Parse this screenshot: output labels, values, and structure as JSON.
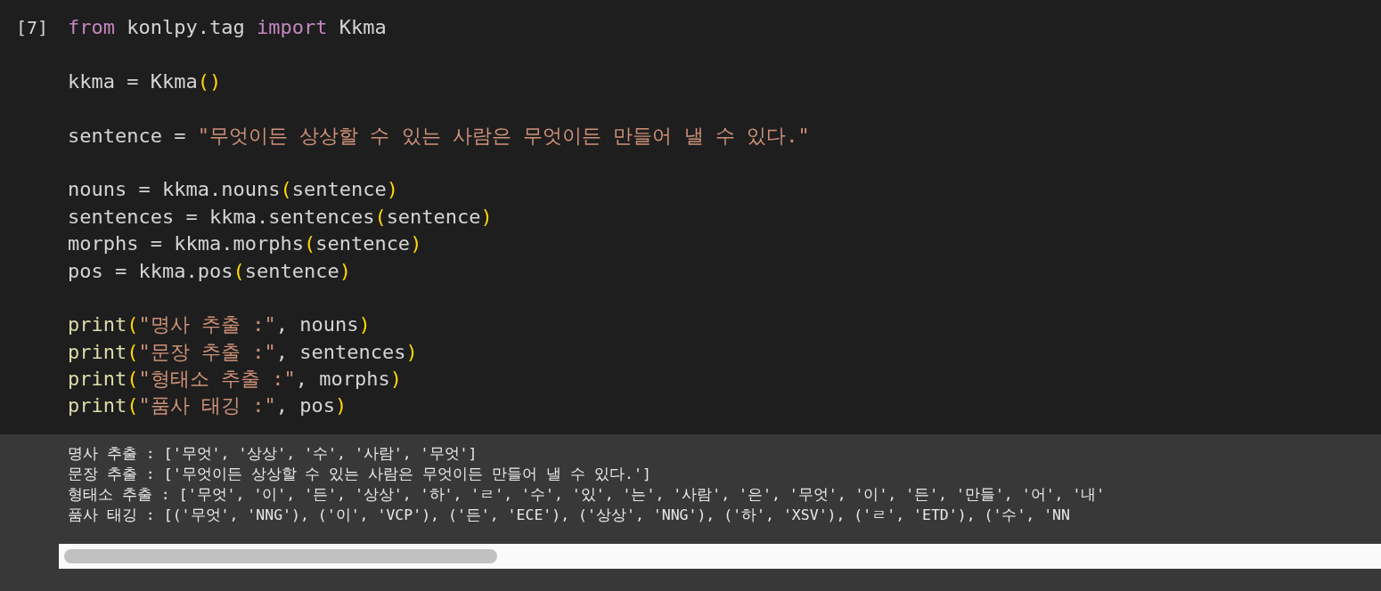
{
  "cell": {
    "execution_count": "[7]",
    "code_lines": [
      {
        "kind": "code",
        "tokens": [
          {
            "kind": "keyword",
            "text": "from"
          },
          {
            "kind": "plain",
            "text": " konlpy.tag "
          },
          {
            "kind": "keyword",
            "text": "import"
          },
          {
            "kind": "plain",
            "text": " Kkma"
          }
        ]
      },
      {
        "kind": "blank"
      },
      {
        "kind": "code",
        "tokens": [
          {
            "kind": "plain",
            "text": "kkma = Kkma"
          },
          {
            "kind": "paren",
            "text": "()"
          }
        ]
      },
      {
        "kind": "blank"
      },
      {
        "kind": "code",
        "tokens": [
          {
            "kind": "plain",
            "text": "sentence = "
          },
          {
            "kind": "string",
            "text": "\"무엇이든 상상할 수 있는 사람은 무엇이든 만들어 낼 수 있다.\""
          }
        ]
      },
      {
        "kind": "blank"
      },
      {
        "kind": "code",
        "tokens": [
          {
            "kind": "plain",
            "text": "nouns = kkma.nouns"
          },
          {
            "kind": "paren",
            "text": "("
          },
          {
            "kind": "plain",
            "text": "sentence"
          },
          {
            "kind": "paren",
            "text": ")"
          }
        ]
      },
      {
        "kind": "code",
        "tokens": [
          {
            "kind": "plain",
            "text": "sentences = kkma.sentences"
          },
          {
            "kind": "paren",
            "text": "("
          },
          {
            "kind": "plain",
            "text": "sentence"
          },
          {
            "kind": "paren",
            "text": ")"
          }
        ]
      },
      {
        "kind": "code",
        "tokens": [
          {
            "kind": "plain",
            "text": "morphs = kkma.morphs"
          },
          {
            "kind": "paren",
            "text": "("
          },
          {
            "kind": "plain",
            "text": "sentence"
          },
          {
            "kind": "paren",
            "text": ")"
          }
        ]
      },
      {
        "kind": "code",
        "tokens": [
          {
            "kind": "plain",
            "text": "pos = kkma.pos"
          },
          {
            "kind": "paren",
            "text": "("
          },
          {
            "kind": "plain",
            "text": "sentence"
          },
          {
            "kind": "paren",
            "text": ")"
          }
        ]
      },
      {
        "kind": "blank"
      },
      {
        "kind": "code",
        "tokens": [
          {
            "kind": "builtin",
            "text": "print"
          },
          {
            "kind": "paren",
            "text": "("
          },
          {
            "kind": "string",
            "text": "\"명사 추출 :\""
          },
          {
            "kind": "plain",
            "text": ", nouns"
          },
          {
            "kind": "paren",
            "text": ")"
          }
        ]
      },
      {
        "kind": "code",
        "tokens": [
          {
            "kind": "builtin",
            "text": "print"
          },
          {
            "kind": "paren",
            "text": "("
          },
          {
            "kind": "string",
            "text": "\"문장 추출 :\""
          },
          {
            "kind": "plain",
            "text": ", sentences"
          },
          {
            "kind": "paren",
            "text": ")"
          }
        ]
      },
      {
        "kind": "code",
        "tokens": [
          {
            "kind": "builtin",
            "text": "print"
          },
          {
            "kind": "paren",
            "text": "("
          },
          {
            "kind": "string",
            "text": "\"형태소 추출 :\""
          },
          {
            "kind": "plain",
            "text": ", morphs"
          },
          {
            "kind": "paren",
            "text": ")"
          }
        ]
      },
      {
        "kind": "code",
        "tokens": [
          {
            "kind": "builtin",
            "text": "print"
          },
          {
            "kind": "paren",
            "text": "("
          },
          {
            "kind": "string",
            "text": "\"품사 태깅 :\""
          },
          {
            "kind": "plain",
            "text": ", pos"
          },
          {
            "kind": "paren",
            "text": ")"
          }
        ]
      }
    ],
    "output_lines": [
      "명사 추출 : ['무엇', '상상', '수', '사람', '무엇']",
      "문장 추출 : ['무엇이든 상상할 수 있는 사람은 무엇이든 만들어 낼 수 있다.']",
      "형태소 추출 : ['무엇', '이', '든', '상상', '하', 'ㄹ', '수', '있', '는', '사람', '은', '무엇', '이', '든', '만들', '어', '내'",
      "품사 태깅 : [('무엇', 'NNG'), ('이', 'VCP'), ('든', 'ECE'), ('상상', 'NNG'), ('하', 'XSV'), ('ㄹ', 'ETD'), ('수', 'NN"
    ]
  }
}
